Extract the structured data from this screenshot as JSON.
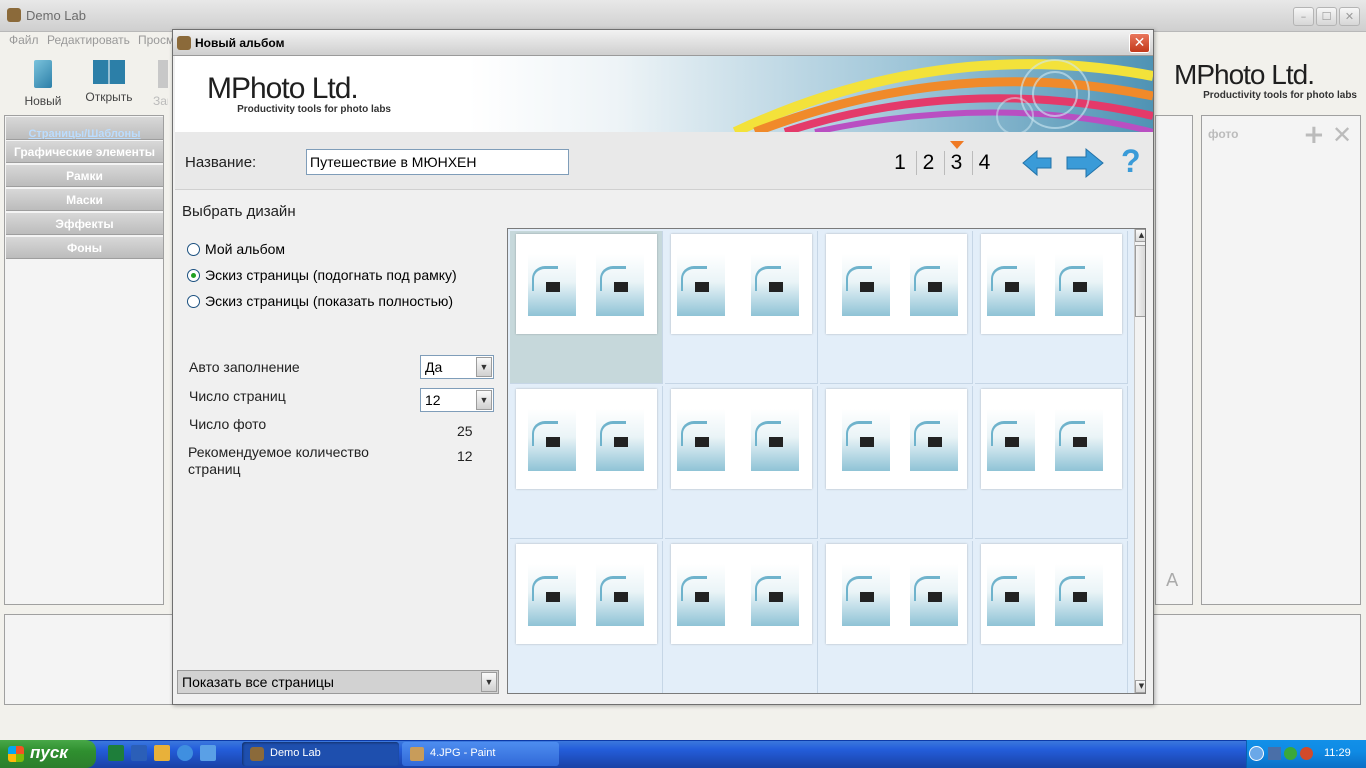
{
  "main": {
    "title": "Demo Lab",
    "menu": [
      "Файл",
      "Редактировать",
      "Просм"
    ],
    "toolbar": {
      "new": "Новый",
      "open": "Открыть",
      "third": "Зан"
    },
    "left_tabs": [
      "Страницы/Шаблоны",
      "Графические элементы",
      "Рамки",
      "Маски",
      "Эффекты",
      "Фоны"
    ],
    "right_panel": {
      "label": "фото"
    }
  },
  "dialog": {
    "title": "Новый альбом",
    "logo": {
      "name": "MPhoto Ltd.",
      "tagline": "Productivity tools for photo labs"
    },
    "name_label": "Название:",
    "name_value": "Путешествие в МЮНХЕН",
    "steps": [
      "1",
      "2",
      "3",
      "4"
    ],
    "current_step": "3",
    "help": "?",
    "section_title": "Выбрать дизайн",
    "radio_options": [
      {
        "label": "Мой альбом",
        "selected": false
      },
      {
        "label": "Эскиз страницы (подогнать под рамку)",
        "selected": true
      },
      {
        "label": "Эскиз страницы (показать полностью)",
        "selected": false
      }
    ],
    "autofill": {
      "label": "Авто заполнение",
      "value": "Да"
    },
    "pages": {
      "label": "Число страниц",
      "value": "12"
    },
    "photos": {
      "label": "Число фото",
      "value": "25"
    },
    "recommended": {
      "label": "Рекомендуемое количество страниц",
      "value": "12"
    },
    "filter": {
      "value": "Показать все страницы"
    },
    "thumbnail_count": 12,
    "selected_thumbnail": 1
  },
  "header_logo_right": {
    "name": "MPhoto Ltd.",
    "tagline": "Productivity tools for photo labs"
  },
  "taskbar": {
    "start": "пуск",
    "tasks": [
      "Demo Lab",
      "4.JPG - Paint"
    ],
    "clock": "11:29"
  },
  "colors": {
    "accent_arrow": "#2f8fd0",
    "dialog_close": "#d24a2a",
    "taskbar": "#245edb",
    "start": "#3a9a3a"
  }
}
